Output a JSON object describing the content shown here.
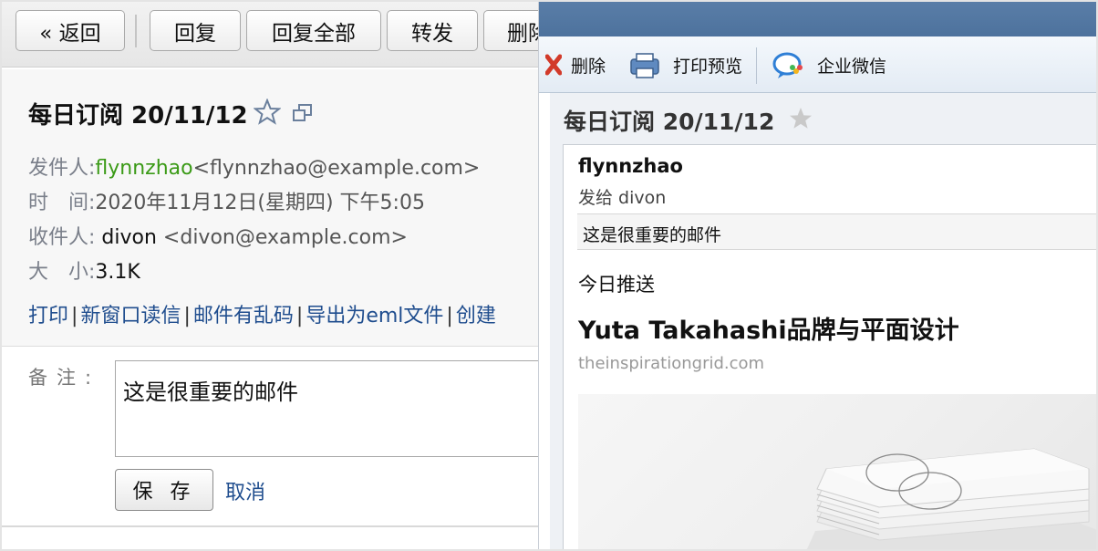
{
  "left": {
    "toolbar": {
      "back": "« 返回",
      "reply": "回复",
      "reply_all": "回复全部",
      "forward": "转发",
      "delete": "删除"
    },
    "subject": "每日订阅 20/11/12",
    "sender": {
      "label": "发件人:",
      "name": "flynnzhao",
      "address": "<flynnzhao@example.com>"
    },
    "time": {
      "label": "时　间:",
      "value": "2020年11月12日(星期四) 下午5:05"
    },
    "recipient": {
      "label": "收件人:",
      "name": "divon",
      "address": "<divon@example.com>"
    },
    "size": {
      "label": "大　小:",
      "value": "3.1K"
    },
    "links": [
      "打印",
      "新窗口读信",
      "邮件有乱码",
      "导出为eml文件",
      "创建"
    ],
    "note": {
      "label": "备注:",
      "value": "这是很重要的邮件"
    },
    "save_label": "保 存",
    "cancel_label": "取消"
  },
  "right": {
    "toolbar": {
      "delete": "删除",
      "print_preview": "打印预览",
      "wechat": "企业微信"
    },
    "subject": "每日订阅 20/11/12",
    "from": "flynnzhao",
    "to": "发给 divon",
    "note": "这是很重要的邮件",
    "push_title": "今日推送",
    "headline": "Yuta Takahashi品牌与平面设计",
    "source": "theinspirationgrid.com"
  },
  "colors": {
    "sender": "#3a9a16",
    "link": "#1f4d8e",
    "titlebar": "#5a7ea8"
  },
  "icons": [
    "star-outline-icon",
    "new-window-icon",
    "delete-icon",
    "print-icon",
    "wechat-icon",
    "star-icon"
  ]
}
